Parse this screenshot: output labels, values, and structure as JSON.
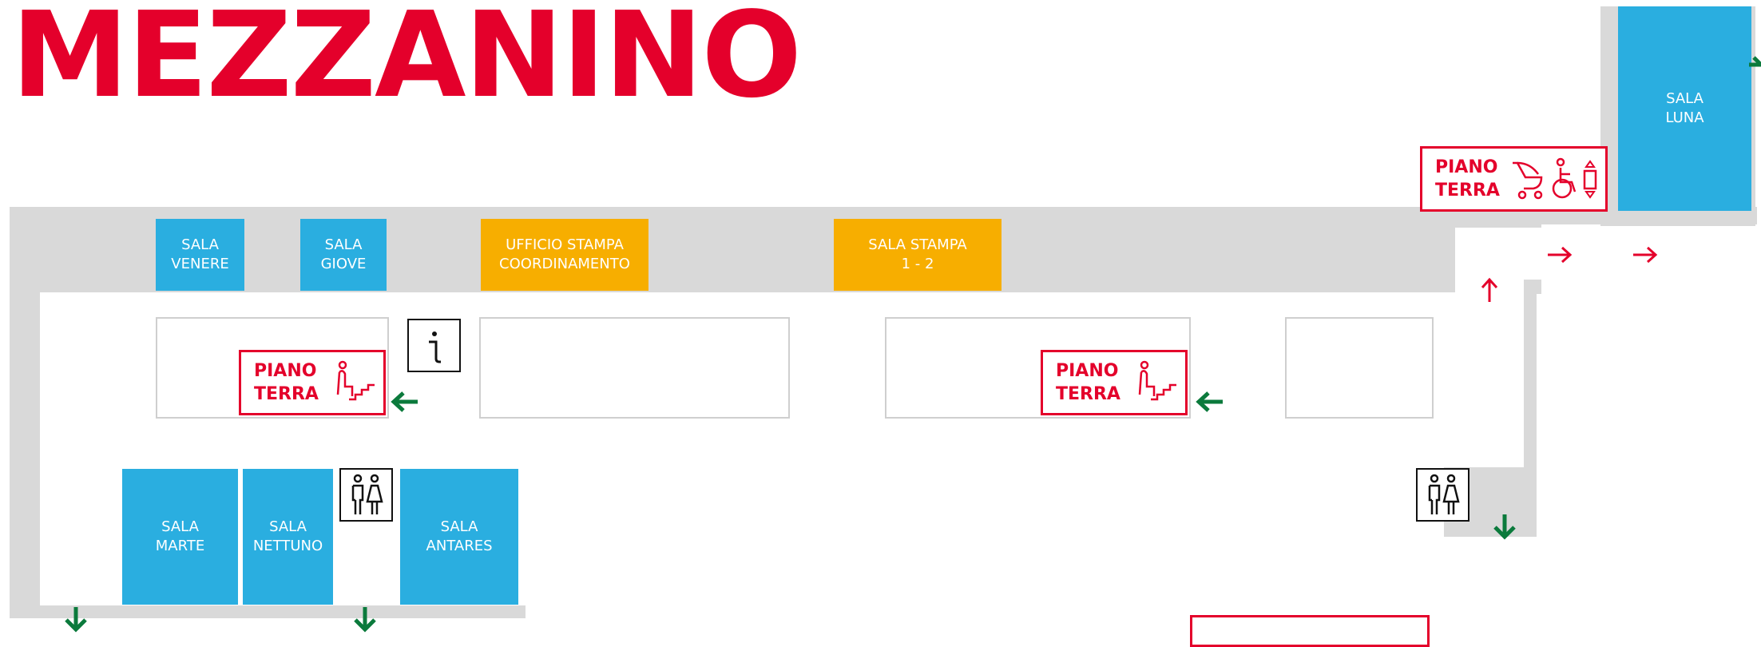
{
  "colors": {
    "title": "#e4002b",
    "room_blue": "#2aaee0",
    "room_yellow": "#f7ae00",
    "sign_red": "#e4002b",
    "arrow_green": "#0b7a3c",
    "corridor": "#d9d9d9"
  },
  "floor_title": "MEZZANINO",
  "rooms": {
    "venere": "SALA\nVENERE",
    "giove": "SALA\nGIOVE",
    "ufficio_stampa": "UFFICIO STAMPA\nCOORDINAMENTO",
    "sala_stampa": "SALA STAMPA\n1 - 2",
    "luna": "SALA\nLUNA",
    "marte": "SALA\nMARTE",
    "nettuno": "SALA\nNETTUNO",
    "antares": "SALA\nANTARES"
  },
  "signs": {
    "stairs_left": "PIANO\nTERRA",
    "stairs_center": "PIANO\nTERRA",
    "elevator": "PIANO\nTERRA"
  },
  "icons": {
    "info": "info-icon",
    "restroom": "restroom-icon",
    "stairs": "stairs-icon",
    "stroller": "stroller-icon",
    "wheelchair": "wheelchair-icon",
    "elevator": "elevator-icon",
    "arrow_left": "arrow-left-icon",
    "arrow_down": "arrow-down-icon",
    "arrow_right": "arrow-right-icon",
    "arrow_up": "arrow-up-icon"
  }
}
